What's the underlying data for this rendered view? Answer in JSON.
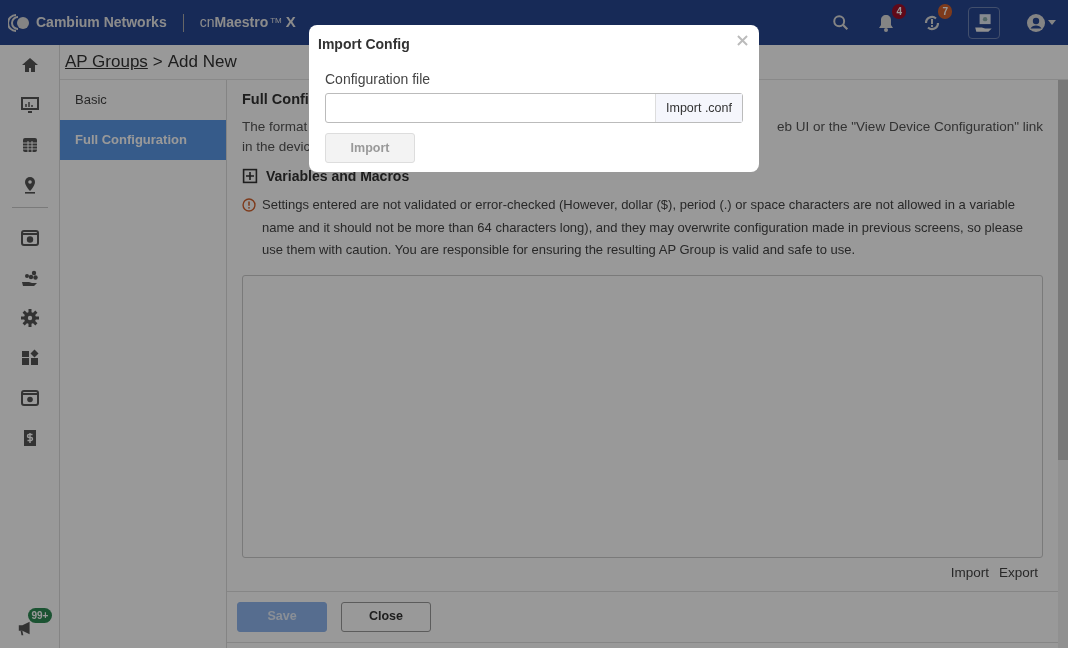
{
  "navbar": {
    "brand": "Cambium Networks",
    "product_prefix": "cn",
    "product_name": "Maestro",
    "trademark": "TM",
    "product_suffix": "X",
    "notification_badge": "4",
    "alarm_badge": "7"
  },
  "rail": {
    "badge": "99+"
  },
  "breadcrumb": {
    "parent": "AP Groups",
    "separator": ">",
    "current": "Add New"
  },
  "subnav": [
    {
      "label": "Basic",
      "selected": false
    },
    {
      "label": "Full Configuration",
      "selected": true
    }
  ],
  "content": {
    "heading": "Full Confi",
    "description_left": "The format",
    "description_right": "eb UI or the \"View Device Configuration\" link",
    "description_line_2": "in the devic",
    "section": "Variables and Macros",
    "warning": "Settings entered are not validated or error-checked (However, dollar ($), period (.) or space characters are not allowed in a variable name and it should not be more than 64 characters long), and they may overwrite configuration made in previous screens, so please use them with caution. You are responsible for ensuring the resulting AP Group is valid and safe to use.",
    "links": [
      "Import",
      "Export"
    ]
  },
  "footer": [
    {
      "label": "Save",
      "kind": "primary",
      "disabled": true
    },
    {
      "label": "Close",
      "kind": "secondary",
      "disabled": false
    }
  ],
  "modal": {
    "title": "Import Config",
    "field_label": "Configuration file",
    "browse_button": "Import .conf",
    "submit": {
      "label": "Import",
      "disabled": true
    }
  }
}
